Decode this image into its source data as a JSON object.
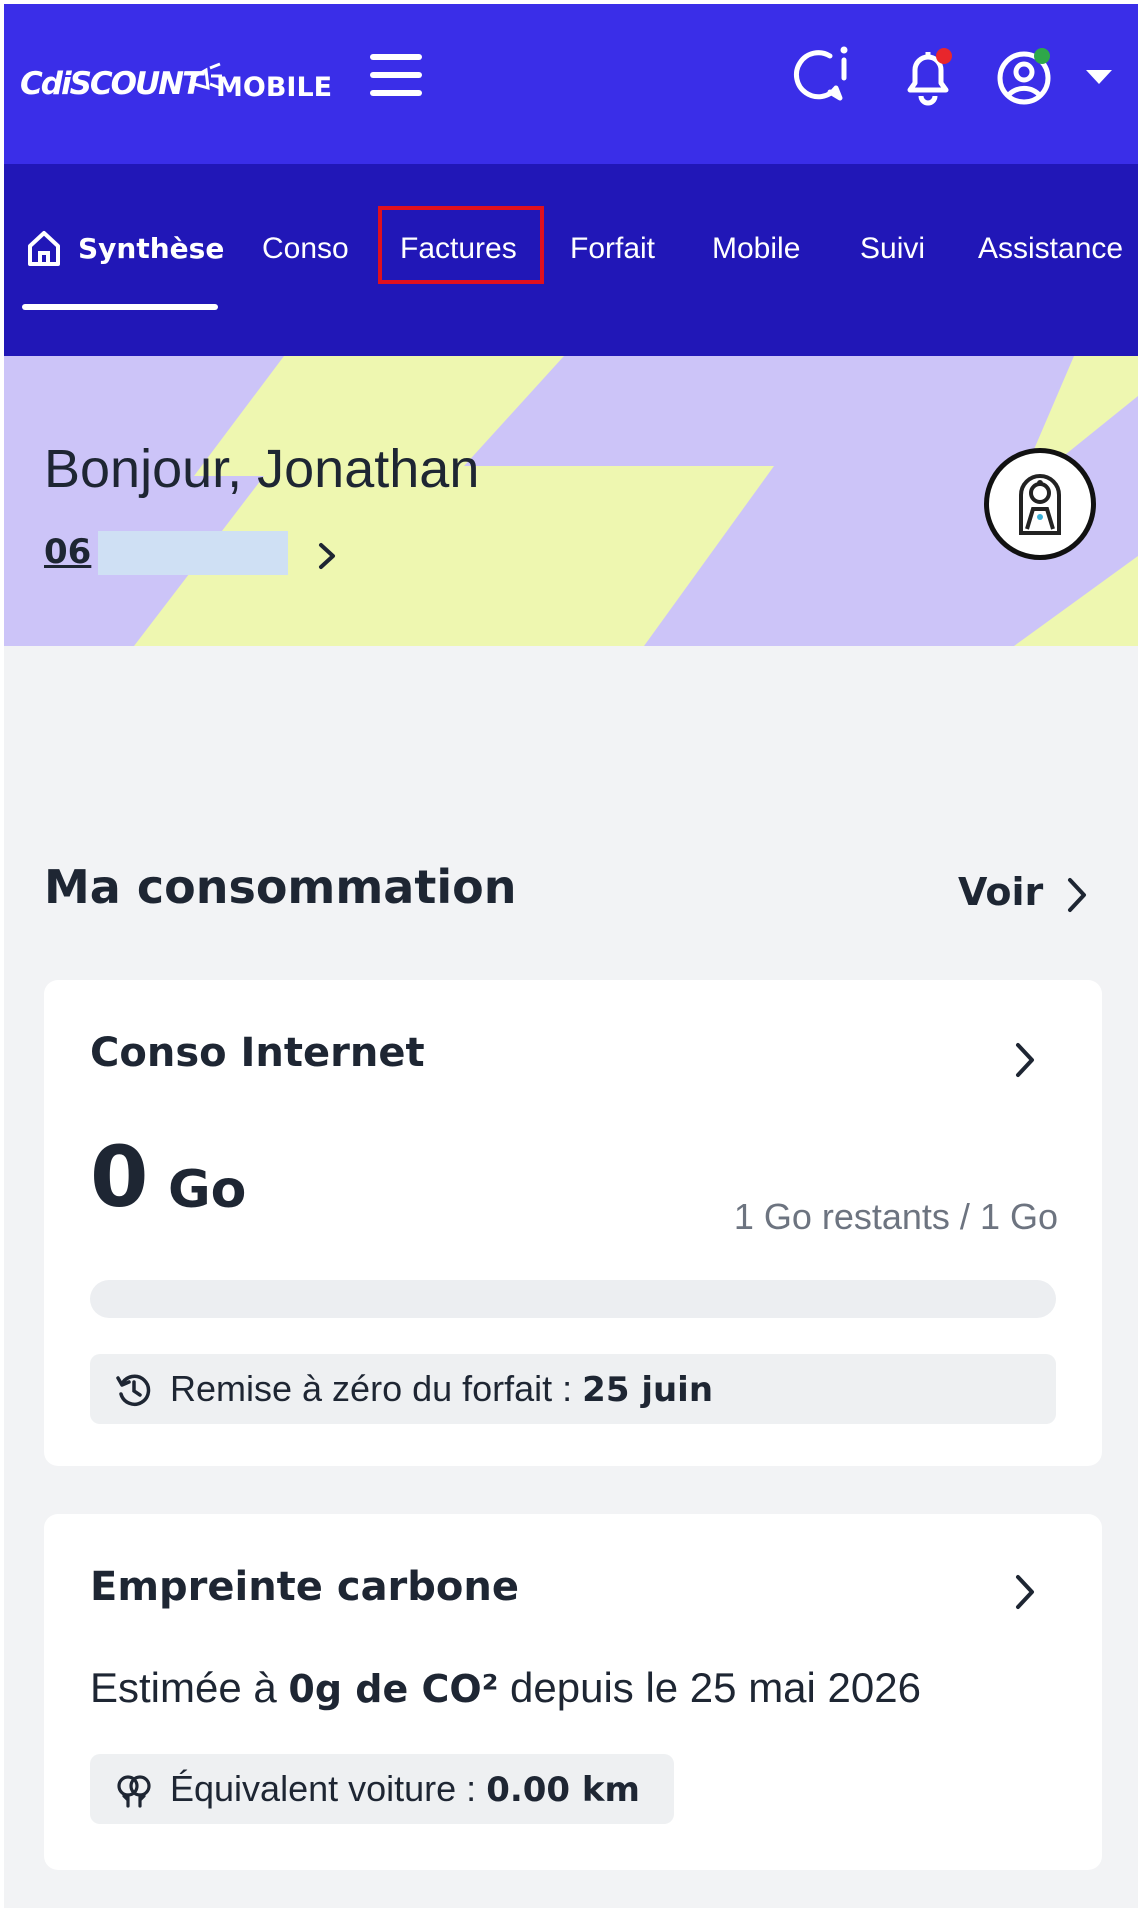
{
  "header": {
    "logo_text": "CdiscountMOBILE",
    "icons": [
      "menu-icon",
      "chat-icon",
      "bell-icon",
      "account-icon",
      "chevron-down-icon"
    ]
  },
  "tabs": [
    {
      "label": "Synthèse",
      "active": true
    },
    {
      "label": "Conso"
    },
    {
      "label": "Factures",
      "highlighted": true
    },
    {
      "label": "Forfait"
    },
    {
      "label": "Mobile"
    },
    {
      "label": "Suivi"
    },
    {
      "label": "Assistance"
    }
  ],
  "banner": {
    "greeting": "Bonjour, Jonathan",
    "phone": "06 "
  },
  "consumption": {
    "title": "Ma consommation",
    "see_label": "Voir"
  },
  "internet_card": {
    "title": "Conso Internet",
    "used_value": "0",
    "used_unit": "Go",
    "remaining": "1 Go restants / 1 Go",
    "usage_fraction": 0,
    "reset_label": "Remise à zéro du forfait : ",
    "reset_date": "25 juin"
  },
  "carbon_card": {
    "title": "Empreinte carbone",
    "estimate_prefix": "Estimée à ",
    "estimate_value": "0g de CO²",
    "estimate_suffix": " depuis le 25 mai 2026",
    "car_label": "Équivalent voiture : ",
    "car_value": "0.00 km"
  },
  "colors": {
    "brand_blue": "#3a2ee8",
    "tabbar_blue": "#2117b7",
    "banner_lilac": "#ccc4f8",
    "banner_yellow": "#eef7b0",
    "highlight_red": "#e0101e",
    "notification_red": "#e8262c",
    "status_green": "#2ea84a"
  }
}
